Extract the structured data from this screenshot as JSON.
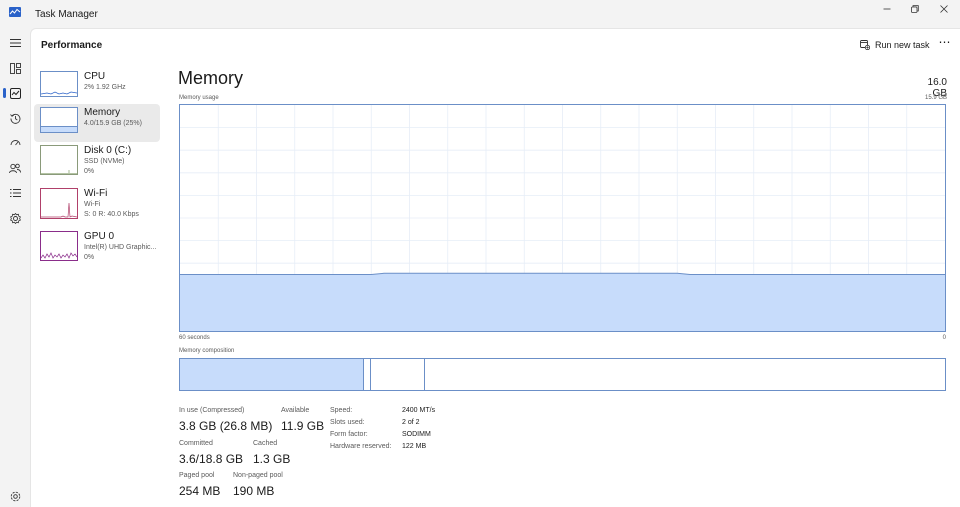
{
  "window": {
    "title": "Task Manager"
  },
  "header": {
    "page_title": "Performance",
    "run_task_label": "Run new task",
    "more_label": "⋯"
  },
  "devices": [
    {
      "name": "CPU",
      "sub1": "2%  1.92 GHz",
      "sub2": ""
    },
    {
      "name": "Memory",
      "sub1": "4.0/15.9 GB (25%)",
      "sub2": ""
    },
    {
      "name": "Disk 0 (C:)",
      "sub1": "SSD (NVMe)",
      "sub2": "0%"
    },
    {
      "name": "Wi-Fi",
      "sub1": "Wi-Fi",
      "sub2": "S: 0  R: 40.0 Kbps"
    },
    {
      "name": "GPU 0",
      "sub1": "Intel(R) UHD Graphic...",
      "sub2": "0%"
    }
  ],
  "memory": {
    "title": "Memory",
    "total": "16.0 GB",
    "usage_label": "Memory usage",
    "usage_max": "15.9 GB",
    "axis_left": "60 seconds",
    "axis_right": "0",
    "composition_label": "Memory composition",
    "usage_level": 0.25,
    "composition": {
      "in_use": 0.24,
      "modified": 0.01,
      "standby": 0.07
    }
  },
  "stats": {
    "in_use_label": "In use (Compressed)",
    "in_use_value": "3.8 GB (26.8 MB)",
    "available_label": "Available",
    "available_value": "11.9 GB",
    "committed_label": "Committed",
    "committed_value": "3.6/18.8 GB",
    "cached_label": "Cached",
    "cached_value": "1.3 GB",
    "paged_label": "Paged pool",
    "paged_value": "254 MB",
    "nonpaged_label": "Non-paged pool",
    "nonpaged_value": "190 MB"
  },
  "specs": [
    {
      "key": "Speed:",
      "value": "2400 MT/s"
    },
    {
      "key": "Slots used:",
      "value": "2 of 2"
    },
    {
      "key": "Form factor:",
      "value": "SODIMM"
    },
    {
      "key": "Hardware reserved:",
      "value": "122 MB"
    }
  ],
  "colors": {
    "accent": "#2a62c9",
    "graph_fill": "#c7dcfb",
    "graph_line": "#6b8fc7",
    "wifi": "#b0406a",
    "gpu": "#8a2d8a"
  },
  "icons": {
    "nav": [
      "hamburger-icon",
      "processes-icon",
      "performance-icon",
      "app-history-icon",
      "startup-apps-icon",
      "users-icon",
      "details-icon",
      "services-icon",
      "settings-icon"
    ],
    "run_task": "run-task-icon"
  }
}
